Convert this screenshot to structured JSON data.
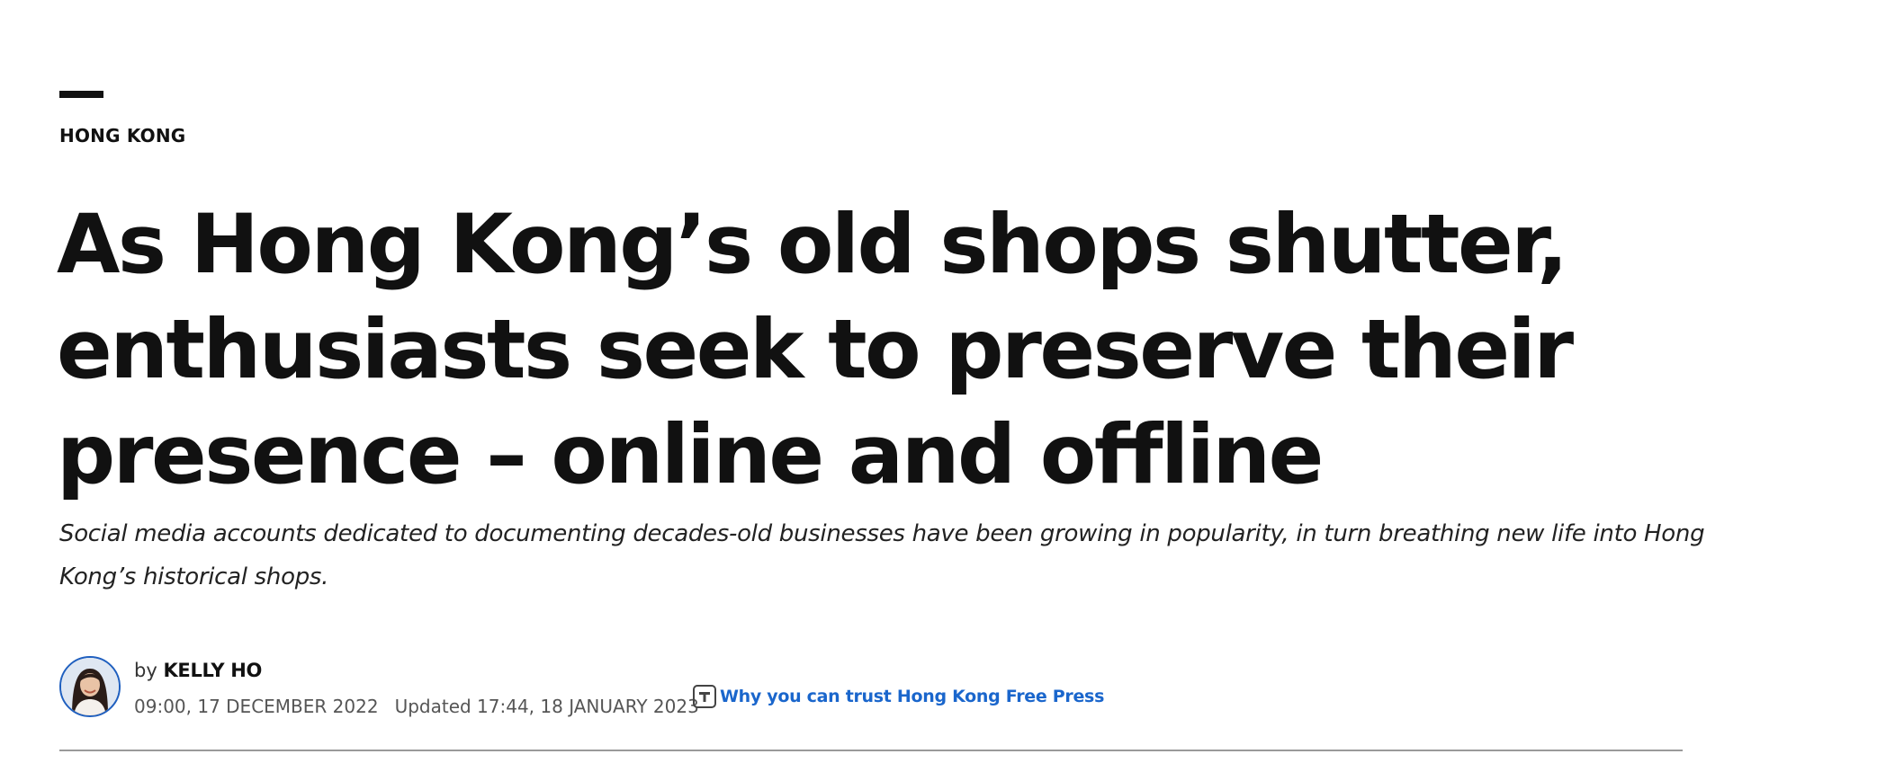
{
  "article": {
    "category": "HONG KONG",
    "headline": "As Hong Kong’s old shops shutter, enthusiasts seek to preserve their presence – online and offline",
    "standfirst": "Social media accounts dedicated to documenting decades-old businesses have been growing in popularity, in turn breathing new life into Hong Kong’s historical shops.",
    "byline": {
      "prefix": "by",
      "author": "KELLY HO",
      "published": "09:00, 17 DECEMBER 2022",
      "updated": "Updated 17:44, 18 JANUARY 2023"
    },
    "trust_link": {
      "label": "Why you can trust Hong Kong Free Press",
      "icon": "trust-t-icon",
      "color": "#1a66cc"
    }
  },
  "colors": {
    "text": "#111111",
    "accent_link": "#1a66cc",
    "avatar_ring": "#1f5fbf",
    "divider": "#9a9a9a"
  }
}
